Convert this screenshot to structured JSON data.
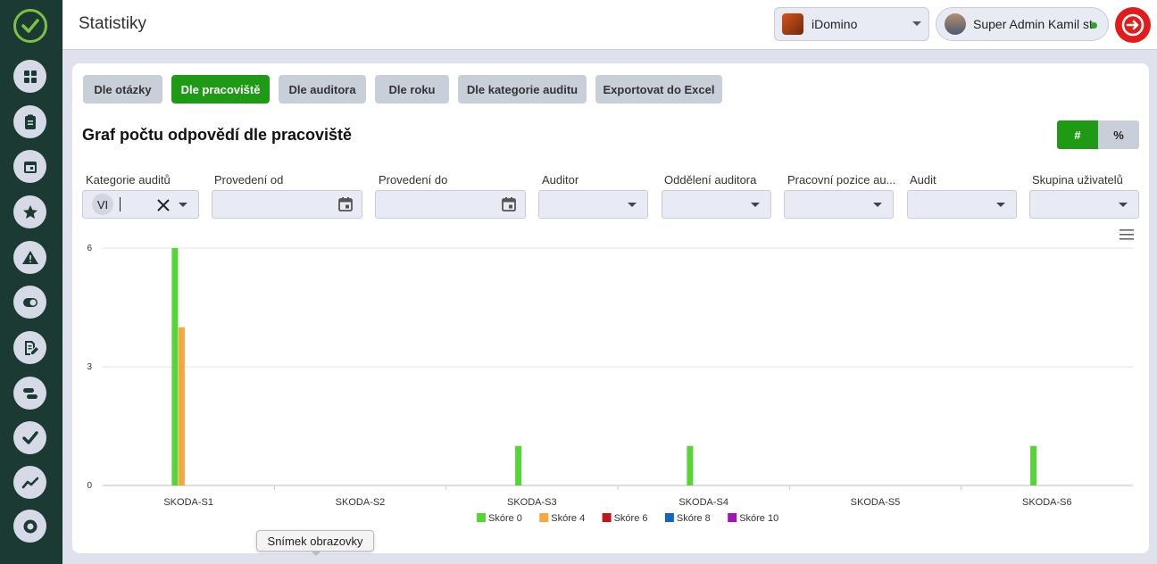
{
  "header": {
    "title": "Statistiky",
    "company": "iDomino",
    "user": "Super Admin Kamil st."
  },
  "sidebar": {
    "items": [
      {
        "icon": "dashboard-icon"
      },
      {
        "icon": "clipboard-icon"
      },
      {
        "icon": "calendar-icon"
      },
      {
        "icon": "star-icon"
      },
      {
        "icon": "warning-icon"
      },
      {
        "icon": "toggle-icon"
      },
      {
        "icon": "edit-document-icon"
      },
      {
        "icon": "timeline-icon"
      },
      {
        "icon": "check-icon"
      },
      {
        "icon": "trend-icon"
      },
      {
        "icon": "settings-icon"
      }
    ]
  },
  "tabs": [
    {
      "label": "Dle otázky",
      "active": false
    },
    {
      "label": "Dle pracoviště",
      "active": true
    },
    {
      "label": "Dle auditora",
      "active": false
    },
    {
      "label": "Dle roku",
      "active": false
    },
    {
      "label": "Dle kategorie auditu",
      "active": false
    },
    {
      "label": "Exportovat do Excel",
      "active": false
    }
  ],
  "chart_title": "Graf počtu odpovědí dle pracoviště",
  "toggle": {
    "count": "#",
    "percent": "%"
  },
  "filters": {
    "kategorie": {
      "label": "Kategorie auditů",
      "chip": "VI"
    },
    "od": {
      "label": "Provedení od"
    },
    "do": {
      "label": "Provedení do"
    },
    "auditor": {
      "label": "Auditor"
    },
    "oddeleni": {
      "label": "Oddělení auditora"
    },
    "pozice": {
      "label": "Pracovní pozice au..."
    },
    "audit": {
      "label": "Audit"
    },
    "skupina": {
      "label": "Skupina uživatelů"
    }
  },
  "tooltip": "Snímek obrazovky",
  "chart_data": {
    "type": "bar",
    "categories": [
      "SKODA-S1",
      "SKODA-S2",
      "SKODA-S3",
      "SKODA-S4",
      "SKODA-S5",
      "SKODA-S6"
    ],
    "series": [
      {
        "name": "Skóre 0",
        "color": "#55d636",
        "values": [
          6,
          0,
          1,
          1,
          0,
          1
        ]
      },
      {
        "name": "Skóre 4",
        "color": "#f5a742",
        "values": [
          4,
          0,
          0,
          0,
          0,
          0
        ]
      },
      {
        "name": "Skóre 6",
        "color": "#c0151b",
        "values": [
          0,
          0,
          0,
          0,
          0,
          0
        ]
      },
      {
        "name": "Skóre 8",
        "color": "#1663c7",
        "values": [
          0,
          0,
          0,
          0,
          0,
          0
        ]
      },
      {
        "name": "Skóre 10",
        "color": "#a314b8",
        "values": [
          0,
          0,
          0,
          0,
          0,
          0
        ]
      }
    ],
    "yticks": [
      0,
      3,
      6
    ],
    "ylim": [
      0,
      6
    ],
    "grid": true,
    "legend": "bottom"
  }
}
